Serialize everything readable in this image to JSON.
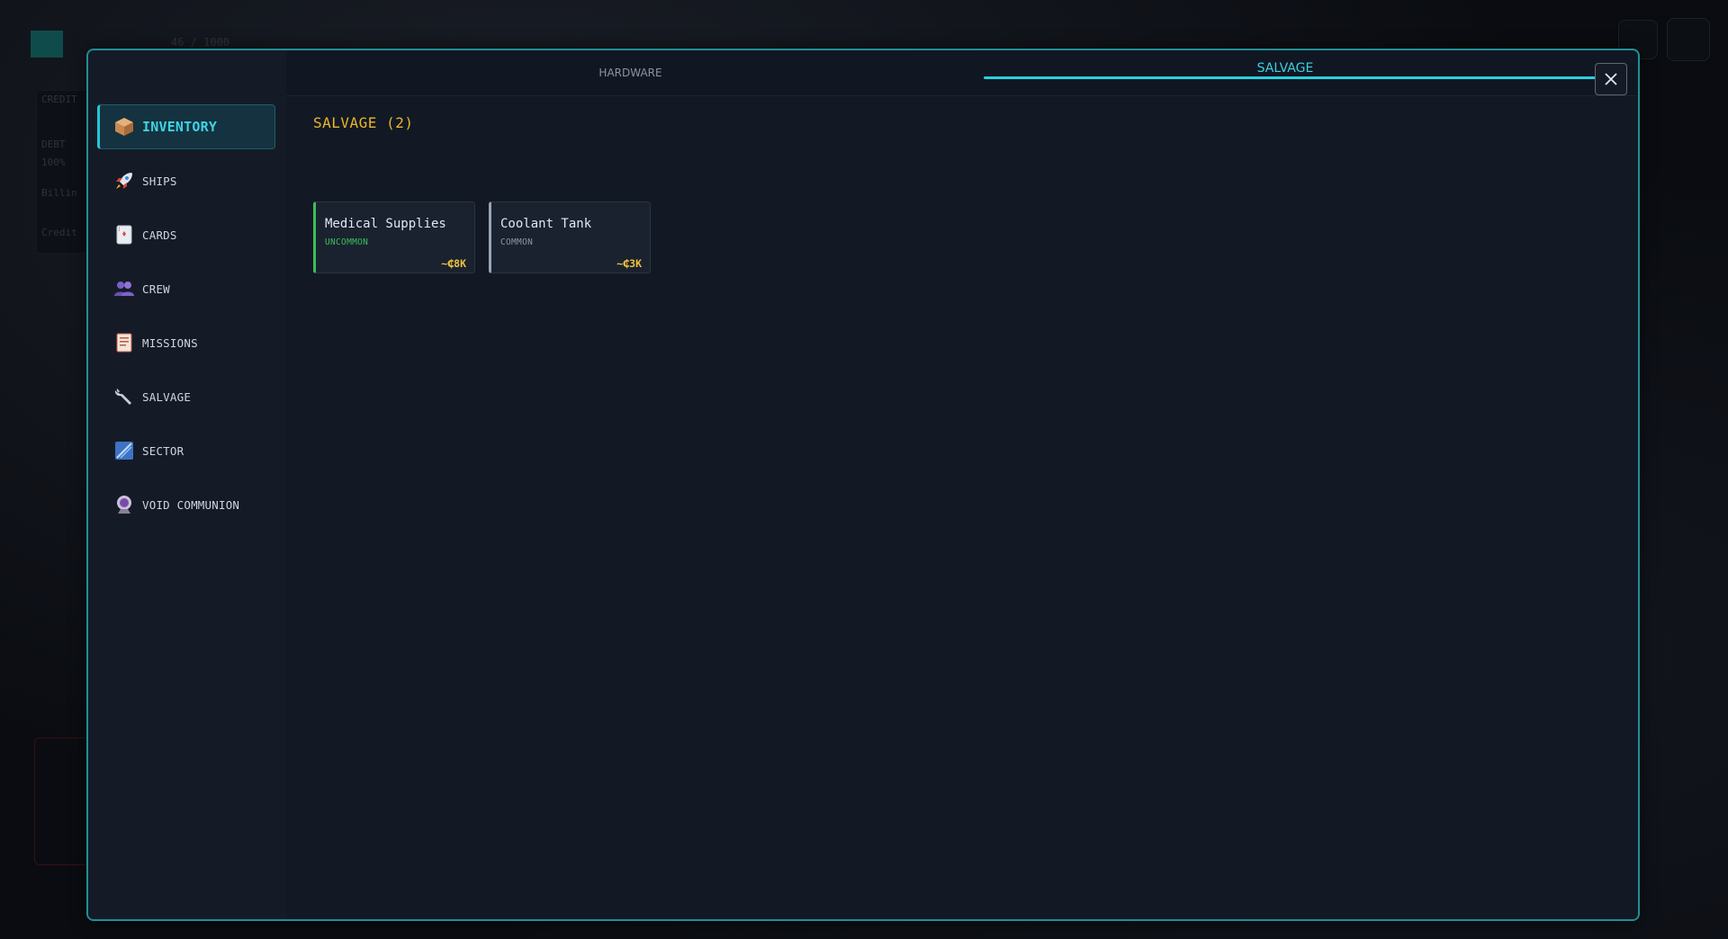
{
  "background_hud": {
    "counter": "46 / 1000",
    "credits_label": "CREDIT",
    "debt_label": "DEBT",
    "debt_value": "100%",
    "billing_label": "Billin",
    "credit_label": "Credit"
  },
  "sidebar": {
    "items": [
      {
        "label": "INVENTORY",
        "icon": "box-icon",
        "active": true
      },
      {
        "label": "SHIPS",
        "icon": "rocket-icon",
        "active": false
      },
      {
        "label": "CARDS",
        "icon": "cards-icon",
        "active": false
      },
      {
        "label": "CREW",
        "icon": "crew-icon",
        "active": false
      },
      {
        "label": "MISSIONS",
        "icon": "missions-icon",
        "active": false
      },
      {
        "label": "SALVAGE",
        "icon": "wrench-icon",
        "active": false
      },
      {
        "label": "SECTOR",
        "icon": "sector-icon",
        "active": false
      },
      {
        "label": "VOID COMMUNION",
        "icon": "void-communion-icon",
        "active": false
      }
    ]
  },
  "tabs": [
    {
      "label": "HARDWARE",
      "active": false
    },
    {
      "label": "SALVAGE",
      "active": true
    }
  ],
  "content": {
    "section_title": "SALVAGE (2)",
    "items": [
      {
        "name": "Medical Supplies",
        "rarity": "UNCOMMON",
        "rarity_color": "#3bbf5a",
        "value": "~₵8K"
      },
      {
        "name": "Coolant Tank",
        "rarity": "COMMON",
        "rarity_color": "#8a94a3",
        "value": "~₵3K"
      }
    ]
  },
  "colors": {
    "accent": "#24c6d6",
    "gold": "#e9b62c",
    "uncommon": "#3bbf5a",
    "common": "#9aa4b2"
  }
}
